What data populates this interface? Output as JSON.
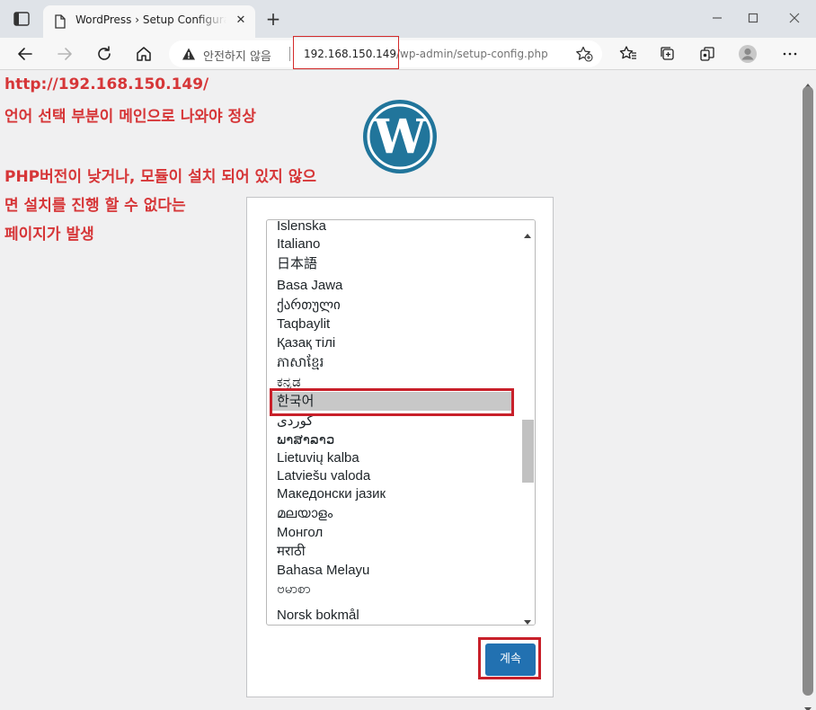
{
  "browser": {
    "tab_title": "WordPress › Setup Configuration File",
    "tab_close": "✕",
    "new_tab": "+",
    "security_label": "안전하지 않음",
    "url_host": "192.168.150.149",
    "url_path": "/wp-admin/setup-config.php"
  },
  "annotations": {
    "line1": "http://192.168.150.149/",
    "line2": "언어 선택 부분이 메인으로 나와야 정상",
    "line3": "PHP버전이 낮거나, 모듈이 설치 되어 있지 않으",
    "line4": "면 설치를 진행 할 수 없다는",
    "line5": "페이지가 발생"
  },
  "setup": {
    "languages": [
      {
        "label": "Íslenska",
        "selected": false
      },
      {
        "label": "Italiano",
        "selected": false
      },
      {
        "label": "日本語",
        "selected": false
      },
      {
        "label": "Basa Jawa",
        "selected": false
      },
      {
        "label": "ქართული",
        "selected": false
      },
      {
        "label": "Taqbaylit",
        "selected": false
      },
      {
        "label": "Қазақ тілі",
        "selected": false
      },
      {
        "label": "ភាសាខ្មែរ",
        "selected": false
      },
      {
        "label": "ಕನ್ನಡ",
        "selected": false
      },
      {
        "label": "한국어",
        "selected": true
      },
      {
        "label": "کوردی",
        "selected": false
      },
      {
        "label": "ພາສາລາວ",
        "selected": false
      },
      {
        "label": "Lietuvių kalba",
        "selected": false
      },
      {
        "label": "Latviešu valoda",
        "selected": false
      },
      {
        "label": "Македонски јазик",
        "selected": false
      },
      {
        "label": "മലയാളം",
        "selected": false
      },
      {
        "label": "Монгол",
        "selected": false
      },
      {
        "label": "मराठी",
        "selected": false
      },
      {
        "label": "Bahasa Melayu",
        "selected": false
      },
      {
        "label": "ဗမာစာ",
        "selected": false
      },
      {
        "label": "Norsk bokmål",
        "selected": false
      }
    ],
    "continue_label": "계속"
  },
  "colors": {
    "annotation": "#d63638",
    "highlight_box": "#c8202a",
    "button": "#2271b1",
    "wp_logo": "#21759b"
  }
}
